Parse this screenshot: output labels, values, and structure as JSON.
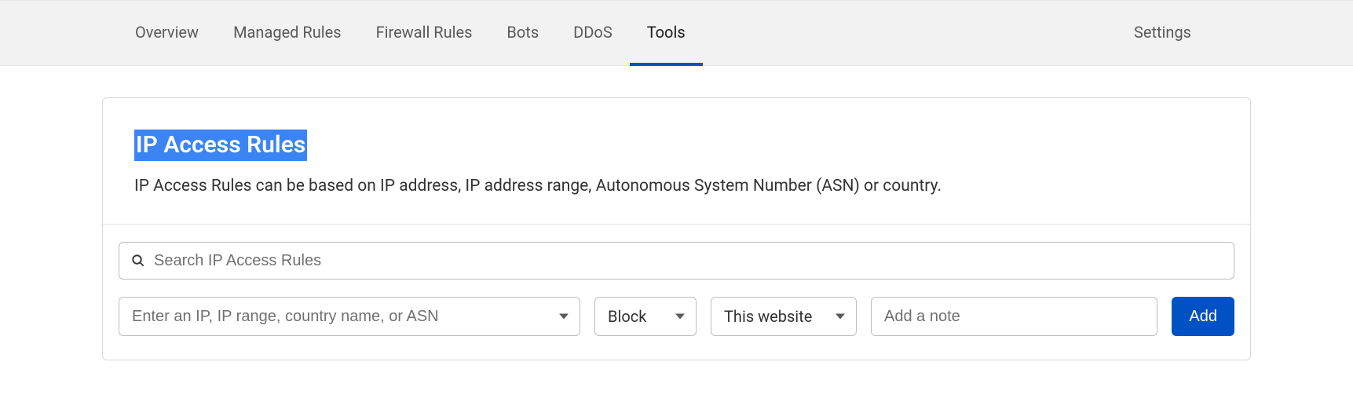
{
  "tabs": {
    "overview": "Overview",
    "managed_rules": "Managed Rules",
    "firewall_rules": "Firewall Rules",
    "bots": "Bots",
    "ddos": "DDoS",
    "tools": "Tools",
    "settings": "Settings",
    "active": "tools"
  },
  "card": {
    "title": "IP Access Rules",
    "description": "IP Access Rules can be based on IP address, IP address range, Autonomous System Number (ASN) or country."
  },
  "search": {
    "placeholder": "Search IP Access Rules",
    "value": ""
  },
  "form": {
    "ip_placeholder": "Enter an IP, IP range, country name, or ASN",
    "ip_value": "",
    "action_selected": "Block",
    "scope_selected": "This website",
    "note_placeholder": "Add a note",
    "note_value": "",
    "add_label": "Add"
  }
}
